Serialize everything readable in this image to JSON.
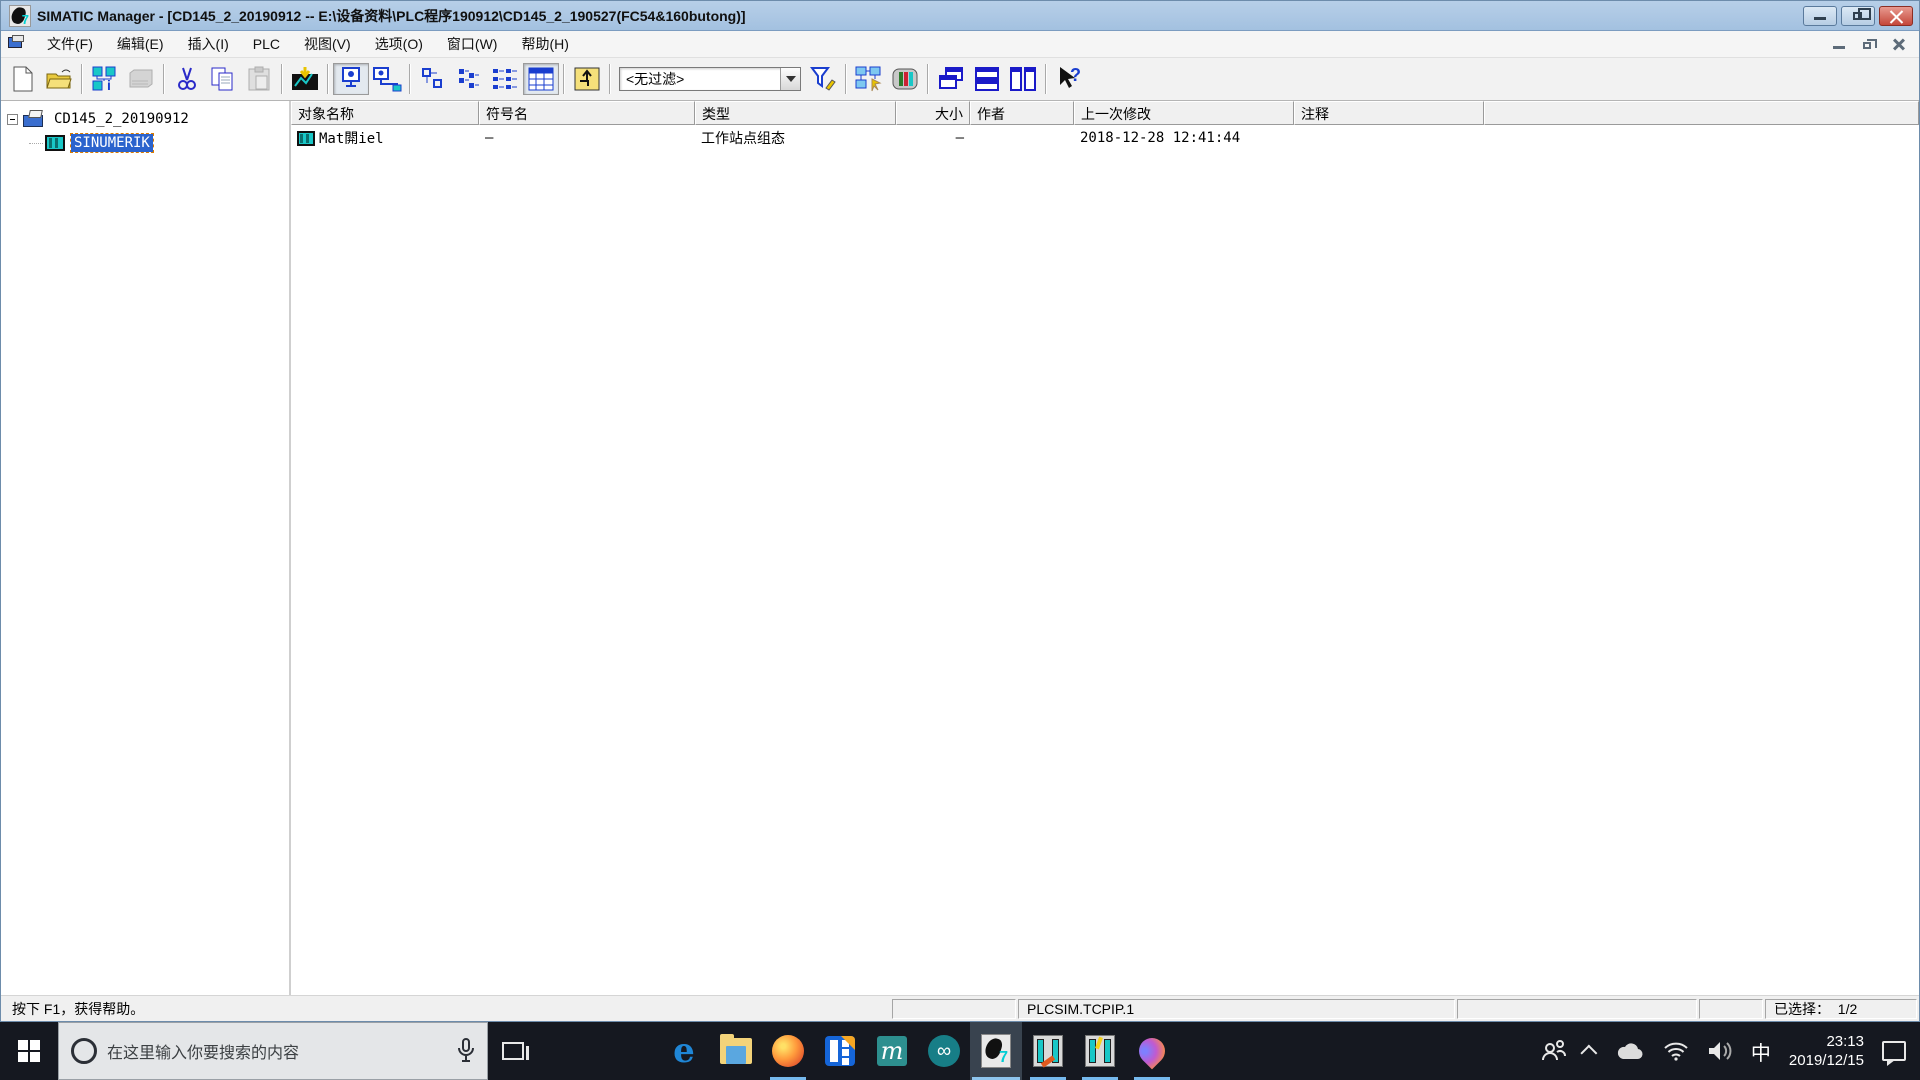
{
  "title_bar": {
    "title": "SIMATIC Manager - [CD145_2_20190912 -- E:\\设备资料\\PLC程序190912\\CD145_2_190527(FC54&160butong)]"
  },
  "menu_bar": {
    "items": [
      "文件(F)",
      "编辑(E)",
      "插入(I)",
      "PLC",
      "视图(V)",
      "选项(O)",
      "窗口(W)",
      "帮助(H)"
    ]
  },
  "toolbar": {
    "filter_value": "<无过滤>",
    "buttons": [
      "new",
      "open",
      "accessible-nodes",
      "memory-card",
      "cut",
      "copy",
      "paste",
      "download",
      "online",
      "offline",
      "icon-view",
      "list-view",
      "tree-view",
      "details-view",
      "up-one-level",
      "filter-edit",
      "simulation",
      "module",
      "cascade-windows",
      "tile-horizontal",
      "tile-vertical",
      "help-pointer"
    ]
  },
  "tree": {
    "root_label": "CD145_2_20190912",
    "child_label": "SINUMERIK"
  },
  "list": {
    "columns": [
      "对象名称",
      "符号名",
      "类型",
      "大小",
      "作者",
      "上一次修改",
      "注释"
    ],
    "rows": [
      {
        "name": "Mat閞iel",
        "symbol": "—",
        "type": "工作站点组态",
        "size": "—",
        "author": "",
        "modified": "2018-12-28 12:41:44",
        "comment": ""
      }
    ]
  },
  "status_bar": {
    "help_text": "按下 F1，获得帮助。",
    "connection": "PLCSIM.TCPIP.1",
    "selected_label": "已选择：",
    "selected_value": "1/2"
  },
  "taskbar": {
    "search_placeholder": "在这里输入你要搜索的内容",
    "apps": [
      "edge",
      "file-explorer",
      "firefox",
      "video-app",
      "m-app",
      "arduino",
      "simatic-manager",
      "plc-editor",
      "hw-config",
      "map-pin-app"
    ],
    "ime_indicator": "中",
    "time": "23:13",
    "date": "2019/12/15"
  },
  "colors": {
    "titlebar": "#a9c5e3",
    "selection": "#2b63cd",
    "taskbar": "#151820",
    "station_teal": "#19c7c7",
    "running_indicator": "#76b9ed"
  }
}
